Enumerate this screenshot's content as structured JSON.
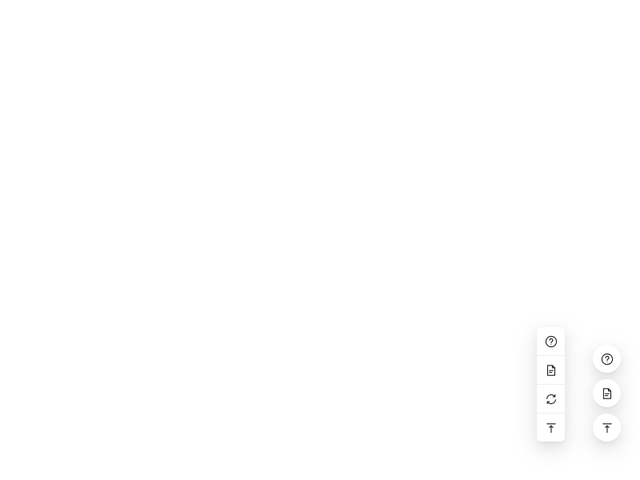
{
  "float_group": {
    "buttons": [
      {
        "icon": "question-circle-icon"
      },
      {
        "icon": "file-text-icon"
      },
      {
        "icon": "sync-icon"
      },
      {
        "icon": "vertical-align-top-icon"
      }
    ]
  },
  "circle_buttons": [
    {
      "icon": "question-circle-icon"
    },
    {
      "icon": "file-text-icon"
    },
    {
      "icon": "vertical-align-top-icon"
    }
  ],
  "colors": {
    "icon": "#1f1f1f",
    "background": "#ffffff",
    "divider": "#f0f0f0"
  }
}
